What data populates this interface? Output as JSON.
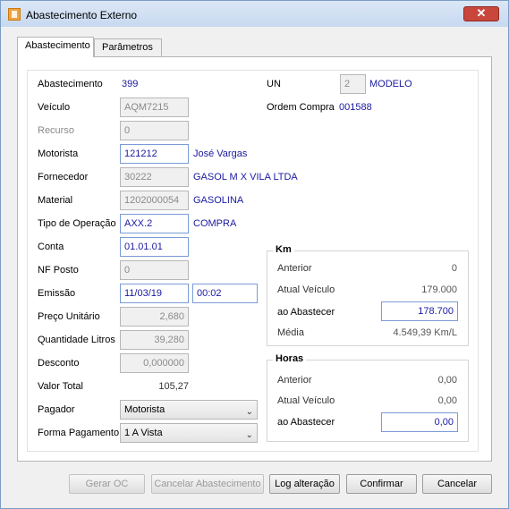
{
  "window": {
    "title": "Abastecimento Externo",
    "close_glyph": "✕"
  },
  "tabs": [
    {
      "label": "Abastecimento"
    },
    {
      "label": "Parâmetros"
    }
  ],
  "form": {
    "abastecimento": {
      "label": "Abastecimento",
      "value": "399"
    },
    "un": {
      "label": "UN",
      "value": "2",
      "name": "MODELO"
    },
    "veiculo": {
      "label": "Veículo",
      "value": "AQM7215"
    },
    "ordem_compra": {
      "label": "Ordem Compra",
      "value": "001588"
    },
    "recurso": {
      "label": "Recurso",
      "value": "0"
    },
    "motorista": {
      "label": "Motorista",
      "value": "121212",
      "name": "José Vargas"
    },
    "fornecedor": {
      "label": "Fornecedor",
      "value": "30222",
      "name": "GASOL M X VILA LTDA"
    },
    "material": {
      "label": "Material",
      "value": "1202000054",
      "name": "GASOLINA"
    },
    "tipo_operacao": {
      "label": "Tipo de Operação",
      "value": "AXX.2",
      "name": "COMPRA"
    },
    "conta": {
      "label": "Conta",
      "value": "01.01.01"
    },
    "nf_posto": {
      "label": "NF Posto",
      "value": "0"
    },
    "emissao": {
      "label": "Emissão",
      "date": "11/03/19",
      "time": "00:02"
    },
    "preco_unitario": {
      "label": "Preço Unitário",
      "value": "2,680"
    },
    "quantidade_litros": {
      "label": "Quantidade Litros",
      "value": "39,280"
    },
    "desconto": {
      "label": "Desconto",
      "value": "0,000000"
    },
    "valor_total": {
      "label": "Valor Total",
      "value": "105,27"
    },
    "pagador": {
      "label": "Pagador",
      "value": "Motorista"
    },
    "forma_pagamento": {
      "label": "Forma Pagamento",
      "value": "1 A Vista"
    }
  },
  "km": {
    "title": "Km",
    "anterior": {
      "label": "Anterior",
      "value": "0"
    },
    "atual_veiculo": {
      "label": "Atual Veículo",
      "value": "179.000"
    },
    "ao_abastecer": {
      "label": "ao Abastecer",
      "value": "178.700"
    },
    "media": {
      "label": "Média",
      "value": "4.549,39 Km/L"
    }
  },
  "horas": {
    "title": "Horas",
    "anterior": {
      "label": "Anterior",
      "value": "0,00"
    },
    "atual_veiculo": {
      "label": "Atual Veículo",
      "value": "0,00"
    },
    "ao_abastecer": {
      "label": "ao Abastecer",
      "value": "0,00"
    }
  },
  "buttons": {
    "gerar_oc": "Gerar OC",
    "cancelar_abastecimento": "Cancelar Abastecimento",
    "log_alteracao": "Log alteração",
    "confirmar": "Confirmar",
    "cancelar": "Cancelar"
  },
  "icons": {
    "chevron": "⌄"
  }
}
